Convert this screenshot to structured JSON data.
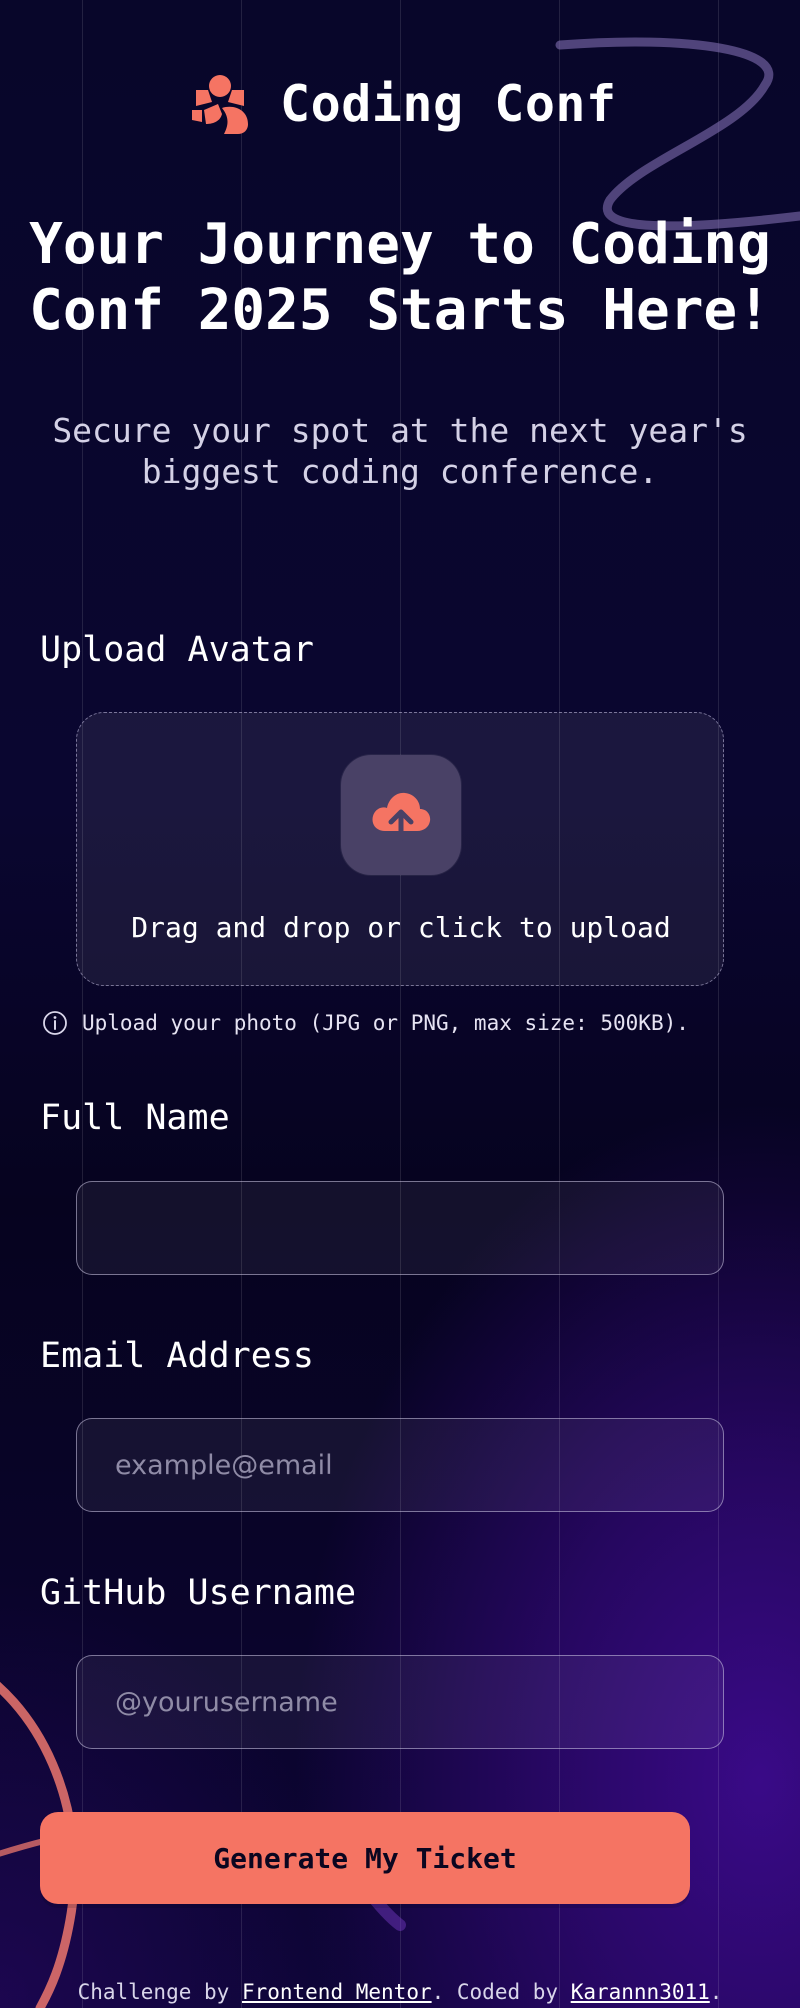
{
  "header": {
    "logo_text": "Coding Conf",
    "logo_icon": "coding-conf-logo-icon"
  },
  "hero": {
    "title_line1": "Your Journey to Coding",
    "title_line2": "Conf 2025 Starts Here!",
    "subtitle_line1": "Secure your spot at the next year's",
    "subtitle_line2": "biggest coding conference."
  },
  "form": {
    "avatar": {
      "label": "Upload Avatar",
      "dropzone_text": "Drag and drop or click to upload",
      "upload_icon": "cloud-upload-icon",
      "hint_icon": "info-icon",
      "hint": "Upload your photo (JPG or PNG, max size: 500KB)."
    },
    "full_name": {
      "label": "Full Name",
      "value": "",
      "placeholder": ""
    },
    "email": {
      "label": "Email Address",
      "value": "",
      "placeholder": "example@email"
    },
    "github": {
      "label": "GitHub Username",
      "value": "",
      "placeholder": "@yourusername"
    },
    "submit_label": "Generate My Ticket"
  },
  "footer": {
    "prefix": "Challenge by ",
    "link1": "Frontend Mentor",
    "middle": ". Coded by ",
    "link2": "Karannn3011",
    "suffix": "."
  },
  "colors": {
    "accent": "#f57463",
    "background": "#0a0630",
    "background_glow": "#3c0a8c",
    "text": "#ffffff",
    "button_text": "#0b0620"
  }
}
